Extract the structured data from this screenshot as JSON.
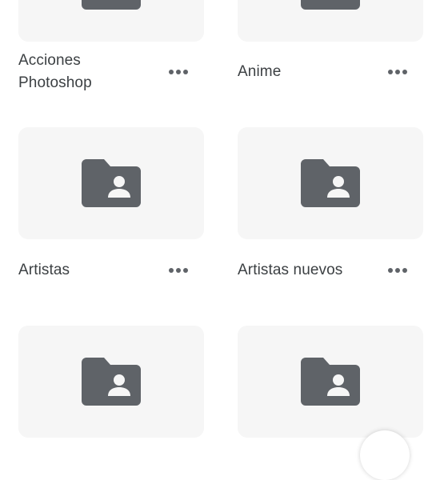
{
  "folders": [
    {
      "name": "Acciones Photoshop",
      "name_line1": "Acciones",
      "name_line2": "Photoshop"
    },
    {
      "name": "Anime"
    },
    {
      "name": "Artistas"
    },
    {
      "name": "Artistas nuevos"
    },
    {
      "name": ""
    },
    {
      "name": ""
    }
  ],
  "icons": {
    "folder": "shared-folder-icon",
    "more": "more-horizontal-icon"
  },
  "colors": {
    "tile_background": "#f6f6f6",
    "icon": "#5f6368",
    "text": "#3c4043"
  }
}
